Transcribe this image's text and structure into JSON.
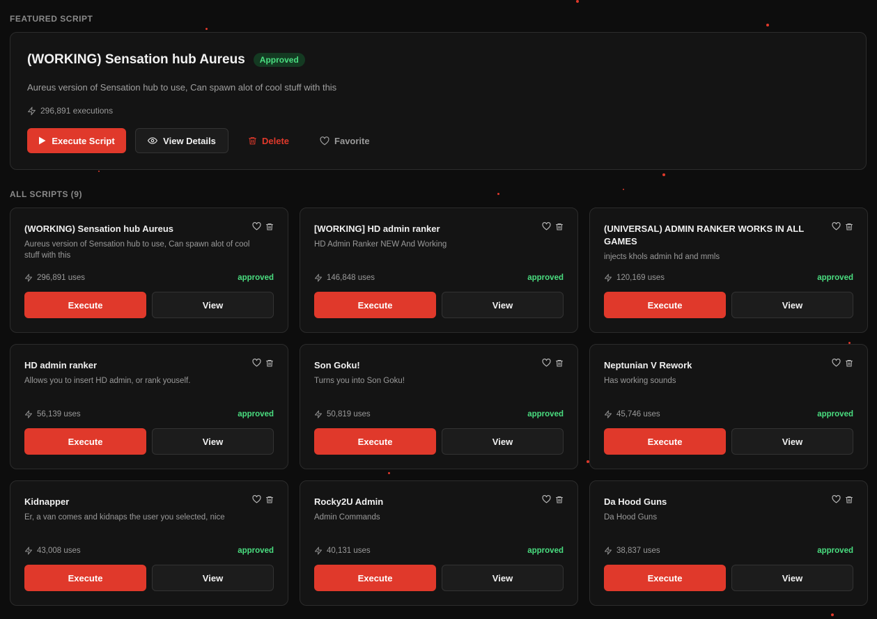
{
  "colors": {
    "accent": "#e0392b",
    "approved": "#4ade80",
    "background": "#0d0d0d",
    "card": "#141414"
  },
  "featured": {
    "section_label": "FEATURED SCRIPT",
    "title": "(WORKING) Sensation hub Aureus",
    "badge": "Approved",
    "description": "Aureus version of Sensation hub to use, Can spawn alot of cool stuff with this",
    "executions": "296,891 executions",
    "execute_label": "Execute Script",
    "view_label": "View Details",
    "delete_label": "Delete",
    "favorite_label": "Favorite"
  },
  "all_scripts": {
    "section_label": "ALL SCRIPTS (9)",
    "execute_label": "Execute",
    "view_label": "View",
    "cards": [
      {
        "title": "(WORKING) Sensation hub Aureus",
        "description": "Aureus version of Sensation hub to use, Can spawn alot of cool stuff with this",
        "uses": "296,891 uses",
        "status": "approved"
      },
      {
        "title": "[WORKING] HD admin ranker",
        "description": "HD Admin Ranker NEW And Working",
        "uses": "146,848 uses",
        "status": "approved"
      },
      {
        "title": "(UNIVERSAL) ADMIN RANKER WORKS IN ALL GAMES",
        "description": "injects khols admin hd and mmls",
        "uses": "120,169 uses",
        "status": "approved"
      },
      {
        "title": "HD admin ranker",
        "description": "Allows you to insert HD admin, or rank youself.",
        "uses": "56,139 uses",
        "status": "approved"
      },
      {
        "title": "Son Goku!",
        "description": "Turns you into Son Goku!",
        "uses": "50,819 uses",
        "status": "approved"
      },
      {
        "title": "Neptunian V Rework",
        "description": "Has working sounds",
        "uses": "45,746 uses",
        "status": "approved"
      },
      {
        "title": "Kidnapper",
        "description": "Er, a van comes and kidnaps the user you selected, nice",
        "uses": "43,008 uses",
        "status": "approved"
      },
      {
        "title": "Rocky2U Admin",
        "description": "Admin Commands",
        "uses": "40,131 uses",
        "status": "approved"
      },
      {
        "title": "Da Hood Guns",
        "description": "Da Hood Guns",
        "uses": "38,837 uses",
        "status": "approved"
      }
    ]
  }
}
